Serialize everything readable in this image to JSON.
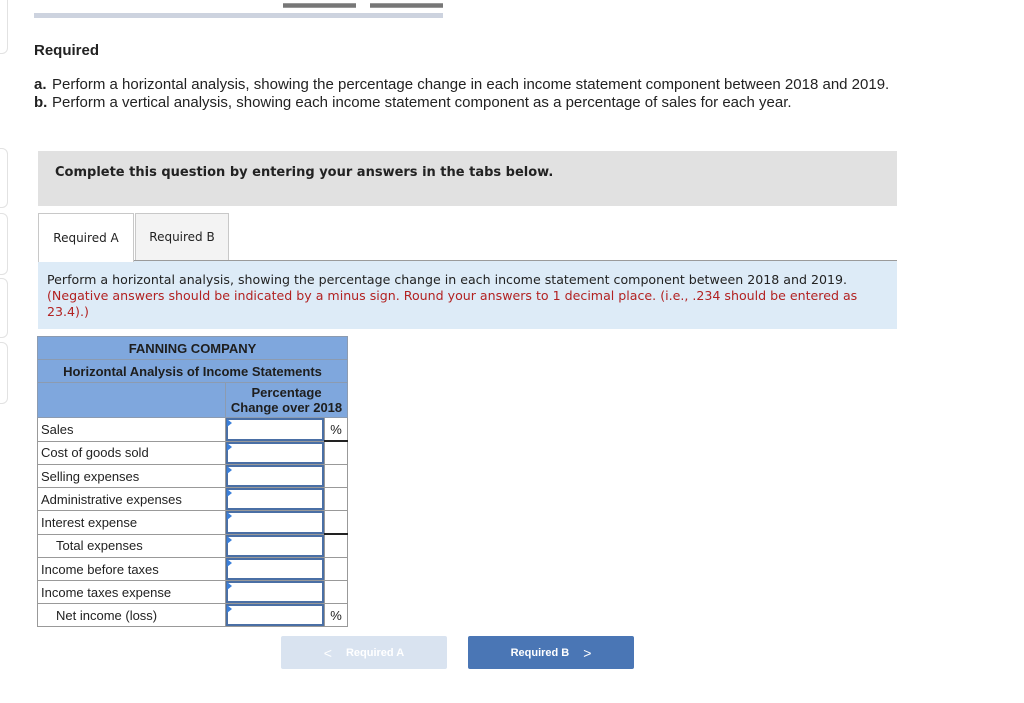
{
  "header": {
    "required_title": "Required",
    "items": [
      {
        "marker": "a.",
        "text": "Perform a horizontal analysis, showing the percentage change in each income statement component between 2018 and 2019."
      },
      {
        "marker": "b.",
        "text": "Perform a vertical analysis, showing each income statement component as a percentage of sales for each year."
      }
    ]
  },
  "instructions": "Complete this question by entering your answers in the tabs below.",
  "tabs": [
    {
      "label": "Required A",
      "active": true
    },
    {
      "label": "Required B",
      "active": false
    }
  ],
  "prompt": {
    "main": "Perform a horizontal analysis, showing the percentage change in each income statement component between 2018 and 2019.",
    "note": "(Negative answers should be indicated by a minus sign. Round your answers to 1 decimal place. (i.e., .234 should be entered as 23.4).)"
  },
  "table": {
    "company": "FANNING COMPANY",
    "title": "Horizontal Analysis of Income Statements",
    "column_header": "Percentage Change over 2018",
    "rows": [
      {
        "label": "Sales",
        "value": "",
        "unit": "%"
      },
      {
        "label": "Cost of goods sold",
        "value": "",
        "unit": ""
      },
      {
        "label": "Selling expenses",
        "value": "",
        "unit": ""
      },
      {
        "label": "Administrative expenses",
        "value": "",
        "unit": ""
      },
      {
        "label": "Interest expense",
        "value": "",
        "unit": ""
      },
      {
        "label": "Total expenses",
        "value": "",
        "unit": ""
      },
      {
        "label": "Income before taxes",
        "value": "",
        "unit": ""
      },
      {
        "label": "Income taxes expense",
        "value": "",
        "unit": ""
      },
      {
        "label": "Net income (loss)",
        "value": "",
        "unit": "%"
      }
    ]
  },
  "navigation": {
    "prev_label": "Required A",
    "next_label": "Required B",
    "prev_icon": "chevron-left-icon",
    "next_icon": "chevron-right-icon"
  },
  "colors": {
    "table_header": "#7fa7dd",
    "prompt_bg": "#ddebf7",
    "note_text": "#b22222",
    "next_button": "#4a76b5",
    "prev_button_disabled": "#d9e3f0"
  }
}
